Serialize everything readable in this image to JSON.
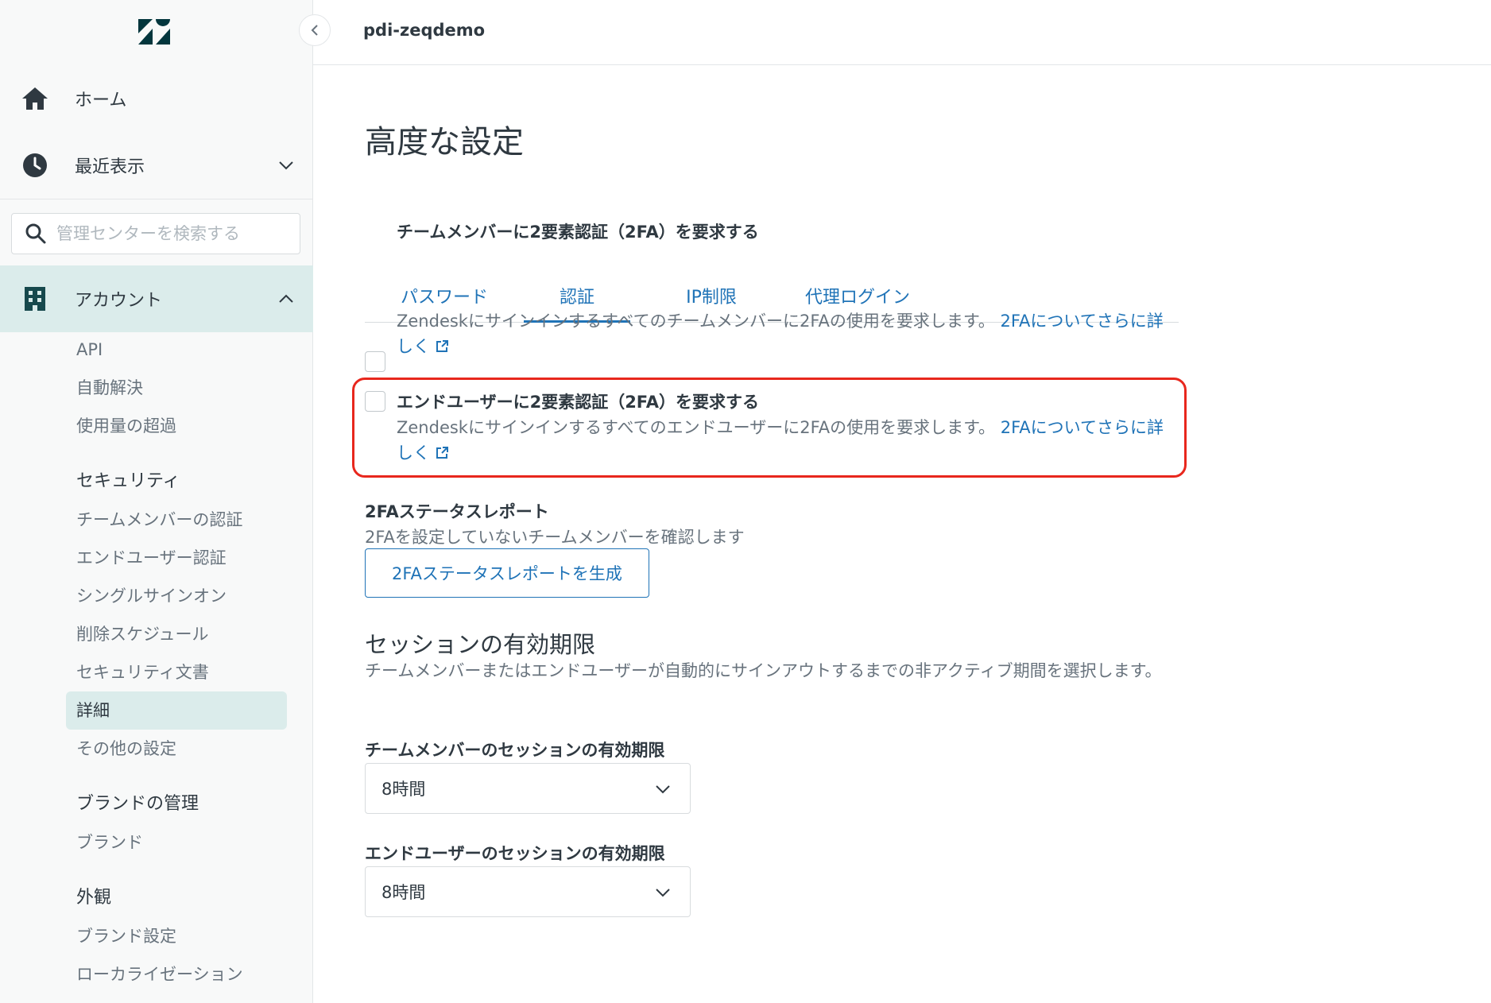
{
  "header": {
    "account_name": "pdi-zeqdemo"
  },
  "sidebar": {
    "home_label": "ホーム",
    "recent_label": "最近表示",
    "search_placeholder": "管理センターを検索する",
    "account_label": "アカウント",
    "account_items": [
      "API",
      "自動解決",
      "使用量の超過"
    ],
    "security_header": "セキュリティ",
    "security_items": [
      "チームメンバーの認証",
      "エンドユーザー認証",
      "シングルサインオン",
      "削除スケジュール",
      "セキュリティ文書",
      "詳細",
      "その他の設定"
    ],
    "brand_header": "ブランドの管理",
    "brand_items": [
      "ブランド"
    ],
    "appearance_header": "外観",
    "appearance_items": [
      "ブランド設定",
      "ローカライゼーション"
    ],
    "active_item": "詳細"
  },
  "main": {
    "page_title": "高度な設定",
    "tabs": [
      {
        "label": "パスワード",
        "active": false
      },
      {
        "label": "認証",
        "active": true
      },
      {
        "label": "IP制限",
        "active": false
      },
      {
        "label": "代理ログイン",
        "active": false
      }
    ],
    "team_2fa": {
      "title": "チームメンバーに2要素認証（2FA）を要求する",
      "desc": "Zendeskにサインインするすべてのチームメンバーに2FAの使用を要求します。",
      "link": "2FAについてさらに詳しく",
      "checked": false
    },
    "enduser_2fa": {
      "title": "エンドユーザーに2要素認証（2FA）を要求する",
      "desc": "Zendeskにサインインするすべてのエンドユーザーに2FAの使用を要求します。",
      "link": "2FAについてさらに詳しく",
      "checked": false
    },
    "report": {
      "title": "2FAステータスレポート",
      "desc": "2FAを設定していないチームメンバーを確認します",
      "button": "2FAステータスレポートを生成"
    },
    "session": {
      "title": "セッションの有効期限",
      "desc": "チームメンバーまたはエンドユーザーが自動的にサインアウトするまでの非アクティブ期間を選択します。",
      "team_label": "チームメンバーのセッションの有効期限",
      "team_value": "8時間",
      "enduser_label": "エンドユーザーのセッションの有効期限",
      "enduser_value": "8時間"
    }
  },
  "colors": {
    "accent": "#1f73b7",
    "sidebar_active": "#dbeceb",
    "highlight": "#e8271d"
  }
}
